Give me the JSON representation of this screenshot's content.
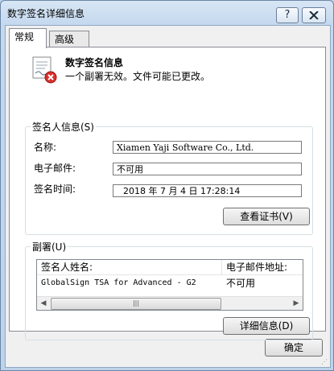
{
  "window": {
    "title": "数字签名详细信息",
    "help_label": "?",
    "close_label": "X"
  },
  "tabs": [
    {
      "label": "常规",
      "active": true
    },
    {
      "label": "高级",
      "active": false
    }
  ],
  "header": {
    "title": "数字签名信息",
    "message": "一个副署无效。文件可能已更改。",
    "icon": "certificate-error-icon"
  },
  "signer": {
    "group_label": "签名人信息(S)",
    "name_label": "名称:",
    "name_value": "Xiamen Yaji Software Co., Ltd.",
    "email_label": "电子邮件:",
    "email_value": "不可用",
    "time_label": "签名时间:",
    "time_value": "2018  年  7  月  4  日 17:28:14",
    "view_cert_label": "查看证书(V)"
  },
  "countersignatures": {
    "group_label": "副署(U)",
    "columns": [
      "签名人姓名:",
      "电子邮件地址:"
    ],
    "rows": [
      {
        "name": "GlobalSign TSA for Advanced - G2",
        "email": "不可用"
      }
    ],
    "details_label": "详细信息(D)"
  },
  "footer": {
    "ok_label": "确定"
  },
  "colors": {
    "title_bar": "#c4d8ee",
    "error_red": "#d9302c"
  }
}
